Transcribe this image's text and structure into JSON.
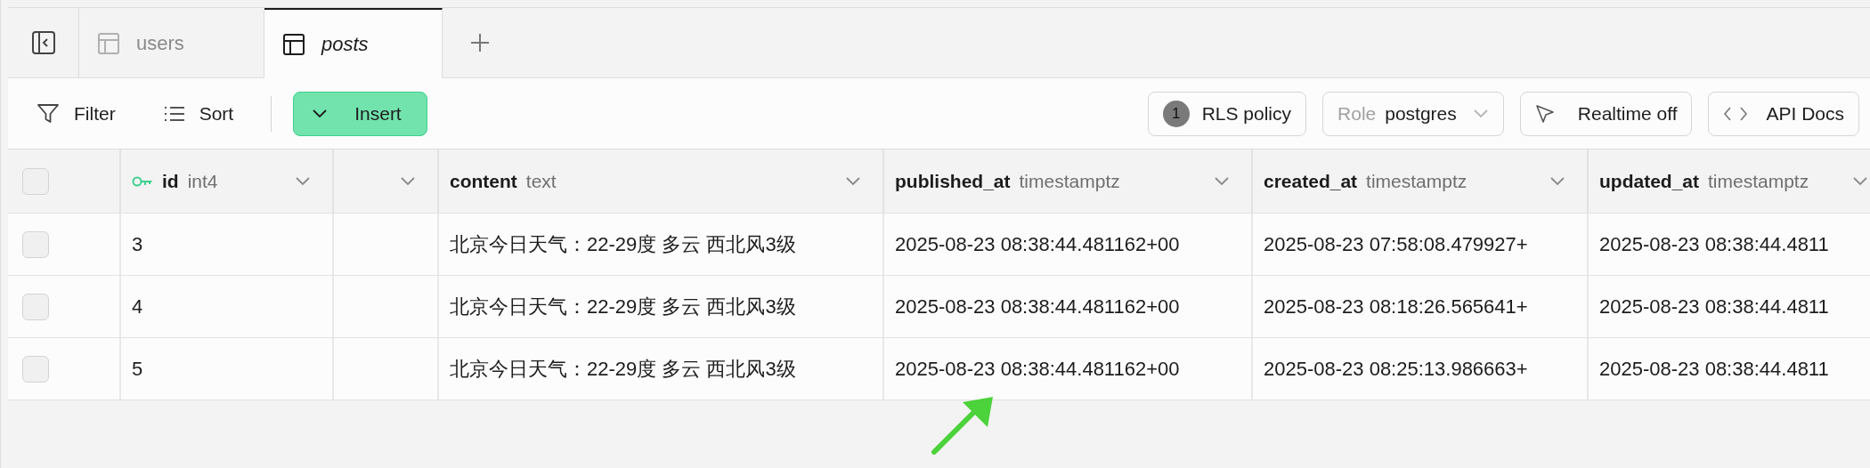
{
  "tabs": [
    {
      "label": "users",
      "selected": false
    },
    {
      "label": "posts",
      "selected": true
    }
  ],
  "toolbar": {
    "filter": "Filter",
    "sort": "Sort",
    "insert": "Insert",
    "rls": {
      "count": "1",
      "label": "RLS policy"
    },
    "role": {
      "label": "Role",
      "value": "postgres"
    },
    "realtime": "Realtime off",
    "api_docs": "API Docs"
  },
  "table": {
    "select_all": {
      "checked": false
    },
    "columns": [
      {
        "kind": "data",
        "name": "id",
        "type": "int4",
        "primary_key": true
      },
      {
        "kind": "blank"
      },
      {
        "kind": "data",
        "name": "content",
        "type": "text",
        "primary_key": false
      },
      {
        "kind": "data",
        "name": "published_at",
        "type": "timestamptz",
        "primary_key": false
      },
      {
        "kind": "data",
        "name": "created_at",
        "type": "timestamptz",
        "primary_key": false
      },
      {
        "kind": "data",
        "name": "updated_at",
        "type": "timestamptz",
        "primary_key": false
      }
    ],
    "rows": [
      {
        "selected": false,
        "cells": [
          "3",
          "",
          "北京今日天气：22-29度 多云 西北风3级",
          "2025-08-23 08:38:44.481162+00",
          "2025-08-23 07:58:08.479927+",
          "2025-08-23 08:38:44.4811"
        ]
      },
      {
        "selected": false,
        "cells": [
          "4",
          "",
          "北京今日天气：22-29度 多云 西北风3级",
          "2025-08-23 08:38:44.481162+00",
          "2025-08-23 08:18:26.565641+",
          "2025-08-23 08:38:44.4811"
        ]
      },
      {
        "selected": false,
        "cells": [
          "5",
          "",
          "北京今日天气：22-29度 多云 西北风3级",
          "2025-08-23 08:38:44.481162+00",
          "2025-08-23 08:25:13.986663+",
          "2025-08-23 08:38:44.4811"
        ]
      }
    ]
  }
}
